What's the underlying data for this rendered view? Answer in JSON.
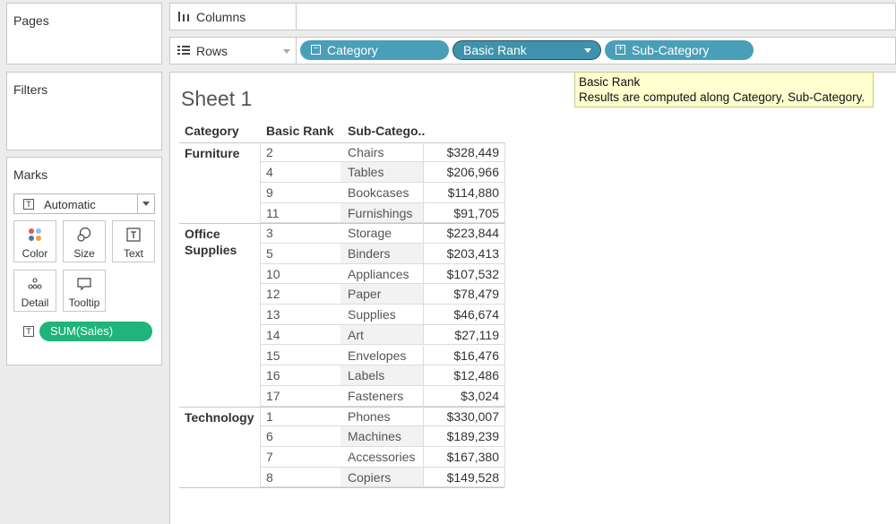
{
  "left_panel": {
    "pages_title": "Pages",
    "filters_title": "Filters",
    "marks_title": "Marks",
    "mark_type": "Automatic",
    "buttons": [
      {
        "id": "color",
        "label": "Color",
        "icon": "color-dots-icon"
      },
      {
        "id": "size",
        "label": "Size",
        "icon": "size-circles-icon"
      },
      {
        "id": "text",
        "label": "Text",
        "icon": "text-t-icon"
      },
      {
        "id": "detail",
        "label": "Detail",
        "icon": "detail-dots-icon"
      },
      {
        "id": "tooltip",
        "label": "Tooltip",
        "icon": "speech-bubble-icon"
      }
    ],
    "mark_pill": "SUM(Sales)",
    "text_icon_glyph": "T"
  },
  "shelves": {
    "columns_label": "Columns",
    "rows_label": "Rows",
    "row_pills": [
      "Category",
      "Basic Rank",
      "Sub-Category"
    ]
  },
  "colors": {
    "dimension_pill": "#4a9fb8",
    "measure_pill": "#1fb47a",
    "tooltip_bg": "#ffffcf"
  },
  "sheet": {
    "title": "Sheet 1"
  },
  "tooltip": {
    "title": "Basic Rank",
    "text": "Results are computed along Category, Sub-Category."
  },
  "table": {
    "headers": {
      "category": "Category",
      "rank": "Basic Rank",
      "subcategory": "Sub-Catego.."
    },
    "groups": [
      {
        "category_lines": [
          "Furniture"
        ],
        "rows": [
          {
            "rank": "2",
            "subcategory": "Chairs",
            "sales": "$328,449"
          },
          {
            "rank": "4",
            "subcategory": "Tables",
            "sales": "$206,966"
          },
          {
            "rank": "9",
            "subcategory": "Bookcases",
            "sales": "$114,880"
          },
          {
            "rank": "11",
            "subcategory": "Furnishings",
            "sales": "$91,705"
          }
        ]
      },
      {
        "category_lines": [
          "Office",
          "Supplies"
        ],
        "rows": [
          {
            "rank": "3",
            "subcategory": "Storage",
            "sales": "$223,844"
          },
          {
            "rank": "5",
            "subcategory": "Binders",
            "sales": "$203,413"
          },
          {
            "rank": "10",
            "subcategory": "Appliances",
            "sales": "$107,532"
          },
          {
            "rank": "12",
            "subcategory": "Paper",
            "sales": "$78,479"
          },
          {
            "rank": "13",
            "subcategory": "Supplies",
            "sales": "$46,674"
          },
          {
            "rank": "14",
            "subcategory": "Art",
            "sales": "$27,119"
          },
          {
            "rank": "15",
            "subcategory": "Envelopes",
            "sales": "$16,476"
          },
          {
            "rank": "16",
            "subcategory": "Labels",
            "sales": "$12,486"
          },
          {
            "rank": "17",
            "subcategory": "Fasteners",
            "sales": "$3,024"
          }
        ]
      },
      {
        "category_lines": [
          "Technology"
        ],
        "rows": [
          {
            "rank": "1",
            "subcategory": "Phones",
            "sales": "$330,007"
          },
          {
            "rank": "6",
            "subcategory": "Machines",
            "sales": "$189,239"
          },
          {
            "rank": "7",
            "subcategory": "Accessories",
            "sales": "$167,380"
          },
          {
            "rank": "8",
            "subcategory": "Copiers",
            "sales": "$149,528"
          }
        ]
      }
    ]
  }
}
